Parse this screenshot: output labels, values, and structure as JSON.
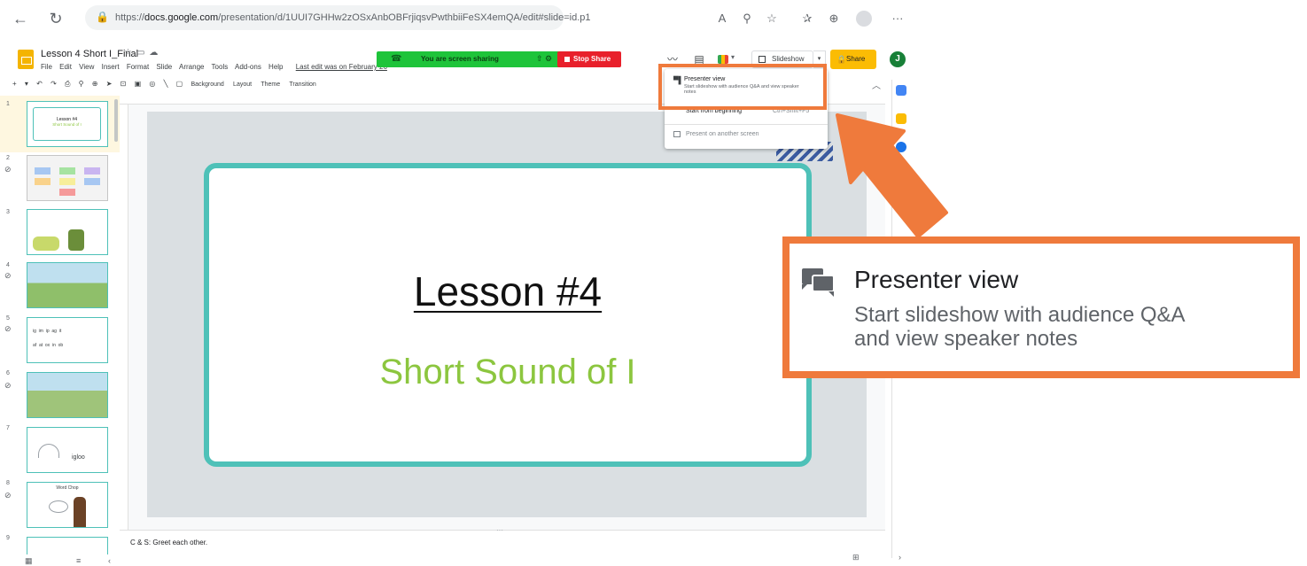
{
  "browser": {
    "url_prefix": "https://",
    "url_host": "docs.google.com",
    "url_path": "/presentation/d/1UUI7GHHw2zOSxAnbOBFrjiqsvPwthbiiFeSX4emQA/edit#slide=id.p1"
  },
  "document": {
    "title": "Lesson 4 Short I_Final"
  },
  "menu": {
    "file": "File",
    "edit": "Edit",
    "view": "View",
    "insert": "Insert",
    "format": "Format",
    "slide": "Slide",
    "arrange": "Arrange",
    "tools": "Tools",
    "addons": "Add-ons",
    "help": "Help",
    "last_edit": "Last edit was on February 26"
  },
  "share_banner": {
    "text": "You are screen sharing",
    "stop": "Stop Share"
  },
  "header": {
    "slideshow_label": "Slideshow",
    "share_label": "Share",
    "user_initial": "J"
  },
  "toolbar": {
    "background": "Background",
    "layout": "Layout",
    "theme": "Theme",
    "transition": "Transition"
  },
  "filmstrip": {
    "numbers": [
      "1",
      "2",
      "3",
      "4",
      "5",
      "6",
      "7",
      "8",
      "9"
    ],
    "thumb1_title": "Lesson #4",
    "thumb1_sub": "Short Sound of I",
    "thumb7_word": "igloo",
    "thumb8_title": "Word Chop",
    "thumb5_row1": "ig  im  ip  ag  it",
    "thumb5_row2": "af  at  ox  in  ob"
  },
  "slide": {
    "title": "Lesson #4",
    "subtitle": "Short Sound of I"
  },
  "notes": {
    "text": "C & S: Greet each other."
  },
  "slideshow_menu": {
    "presenter_title": "Presenter view",
    "presenter_desc": "Start slideshow with audience Q&A and view speaker notes",
    "start_beginning": "Start from beginning",
    "start_shortcut": "Ctrl+Shift+F5",
    "another_screen": "Present on another screen"
  },
  "callout": {
    "title": "Presenter view",
    "desc_line1": "Start slideshow with audience Q&A",
    "desc_line2": "and view speaker notes"
  },
  "colors": {
    "accent_orange": "#ef7a3c",
    "slide_teal": "#4ec1b8",
    "subtitle_green": "#8cc63f",
    "share_yellow": "#fbbc04"
  }
}
